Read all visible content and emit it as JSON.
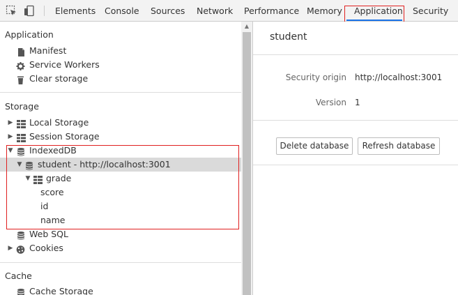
{
  "toolbar": {
    "tabs": [
      {
        "label": "Elements"
      },
      {
        "label": "Console"
      },
      {
        "label": "Sources"
      },
      {
        "label": "Network"
      },
      {
        "label": "Performance"
      },
      {
        "label": "Memory"
      },
      {
        "label": "Application",
        "active": true
      },
      {
        "label": "Security"
      }
    ],
    "accent_color": "#1a73e8",
    "highlight_color": "#e02020"
  },
  "sidebar": {
    "application": {
      "title": "Application",
      "items": [
        {
          "label": "Manifest",
          "icon": "document-icon"
        },
        {
          "label": "Service Workers",
          "icon": "gear-icon"
        },
        {
          "label": "Clear storage",
          "icon": "trash-icon"
        }
      ]
    },
    "storage": {
      "title": "Storage",
      "local_storage": "Local Storage",
      "session_storage": "Session Storage",
      "indexeddb": "IndexedDB",
      "database": "student - http://localhost:3001",
      "store": "grade",
      "indexes": [
        "score",
        "id",
        "name"
      ],
      "websql": "Web SQL",
      "cookies": "Cookies"
    },
    "cache": {
      "title": "Cache",
      "cache_storage": "Cache Storage"
    }
  },
  "main": {
    "title": "student",
    "security_origin_label": "Security origin",
    "security_origin_value": "http://localhost:3001",
    "version_label": "Version",
    "version_value": "1",
    "delete_button": "Delete database",
    "refresh_button": "Refresh database"
  }
}
